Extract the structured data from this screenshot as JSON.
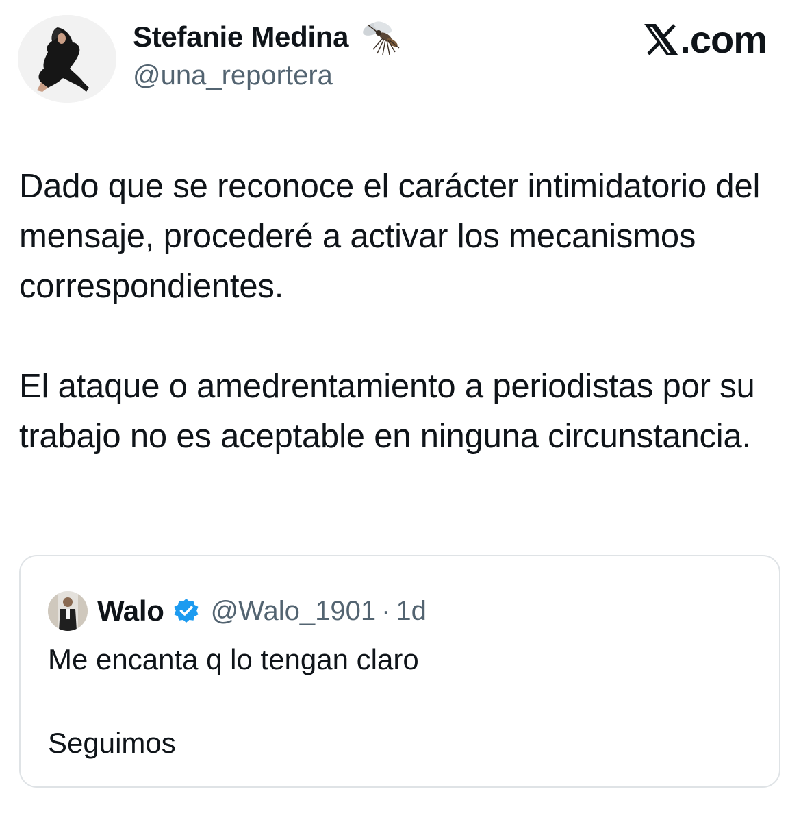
{
  "author": {
    "display_name": "Stefanie Medina",
    "name_emoji": "mosquito-emoji",
    "handle": "@una_reportera"
  },
  "brand": {
    "icon": "x-logo-icon",
    "text": ".com"
  },
  "tweet": {
    "paragraph_1": "Dado que se reconoce el carácter intimidatorio del mensaje, procederé a activar los mecanismos correspondientes.",
    "paragraph_2": "El ataque o amedrentamiento a periodistas por su trabajo no es aceptable en ninguna circunstancia."
  },
  "quoted_tweet": {
    "display_name": "Walo",
    "verified_icon": "verified-badge-icon",
    "handle": "@Walo_1901",
    "separator": "·",
    "time": "1d",
    "line_1": "Me encanta q lo tengan claro",
    "line_2": "Seguimos"
  },
  "colors": {
    "text_primary": "#0f1419",
    "text_secondary": "#536471",
    "verified_blue": "#1d9bf0",
    "border": "#dfe3e6"
  }
}
